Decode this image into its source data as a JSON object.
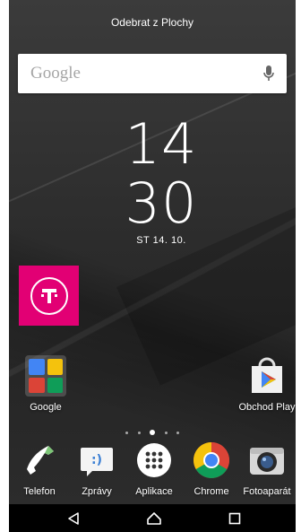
{
  "topbar": {
    "title": "Odebrat z Plochy"
  },
  "search": {
    "placeholder": "Google",
    "mic_icon": "mic-icon"
  },
  "clock": {
    "hours": "14",
    "minutes": "30",
    "date": "ST 14. 10."
  },
  "widgets": {
    "tmobile_icon": "t-mobile-icon"
  },
  "desktop": {
    "items": [
      {
        "label": "Google",
        "icon": "google-folder-icon"
      },
      {
        "label": "Obchod Play",
        "icon": "play-store-icon"
      }
    ]
  },
  "page_indicator": {
    "count": 5,
    "active_index": 2
  },
  "dock": {
    "items": [
      {
        "label": "Telefon",
        "icon": "phone-icon"
      },
      {
        "label": "Zprávy",
        "icon": "messages-icon"
      },
      {
        "label": "Aplikace",
        "icon": "app-drawer-icon"
      },
      {
        "label": "Chrome",
        "icon": "chrome-icon"
      },
      {
        "label": "Fotoaparát",
        "icon": "camera-icon"
      }
    ]
  },
  "navbar": {
    "back": "back-icon",
    "home": "home-icon",
    "recents": "recents-icon"
  },
  "colors": {
    "tmobile": "#e20074",
    "chrome_red": "#db4437",
    "chrome_yellow": "#f4c20d",
    "chrome_green": "#0f9d58",
    "chrome_blue": "#4285f4"
  }
}
